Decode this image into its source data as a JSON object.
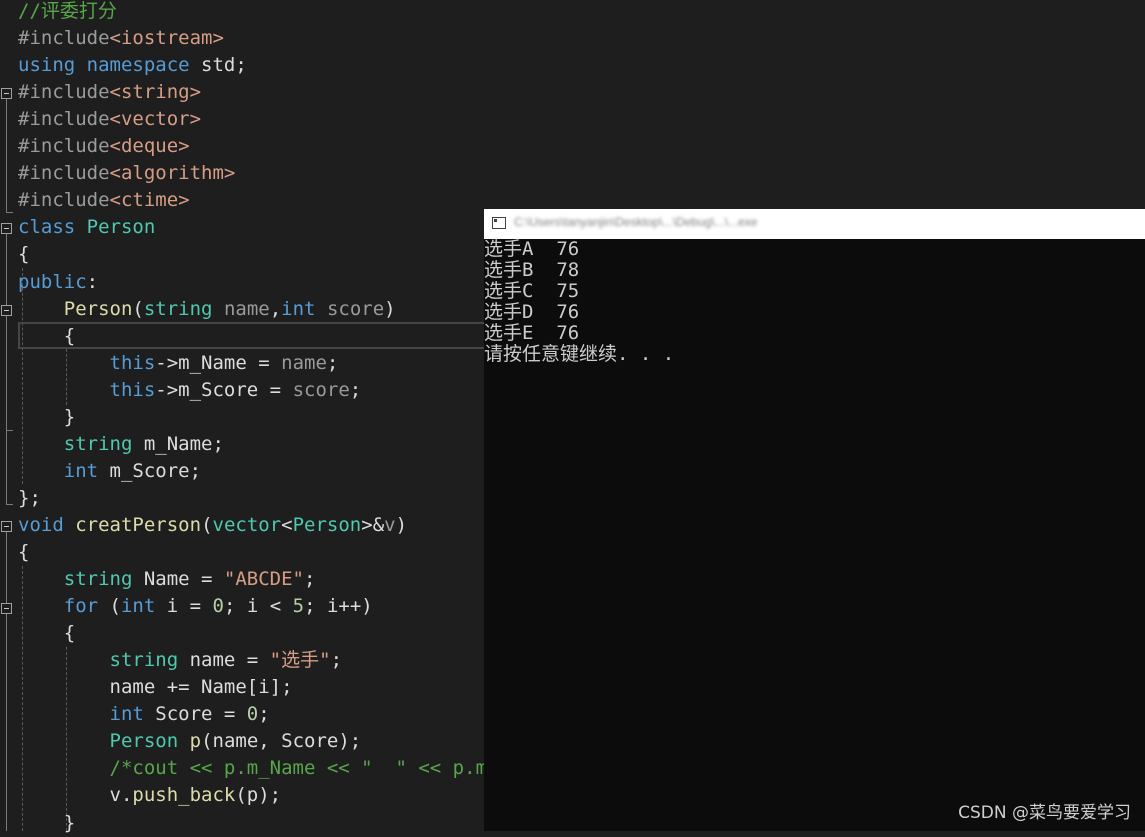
{
  "editor": {
    "lines": [
      [
        {
          "t": "//评委打分",
          "c": "com"
        }
      ],
      [
        {
          "t": "#include",
          "c": "pre"
        },
        {
          "t": "<iostream>",
          "c": "str"
        }
      ],
      [
        {
          "t": "using",
          "c": "kw"
        },
        {
          "t": " ",
          "c": "txt"
        },
        {
          "t": "namespace",
          "c": "kw"
        },
        {
          "t": " std;",
          "c": "txt"
        }
      ],
      [
        {
          "t": "#include",
          "c": "pre"
        },
        {
          "t": "<string>",
          "c": "str"
        }
      ],
      [
        {
          "t": "#include",
          "c": "pre"
        },
        {
          "t": "<vector>",
          "c": "str"
        }
      ],
      [
        {
          "t": "#include",
          "c": "pre"
        },
        {
          "t": "<deque>",
          "c": "str"
        }
      ],
      [
        {
          "t": "#include",
          "c": "pre"
        },
        {
          "t": "<algorithm>",
          "c": "str"
        }
      ],
      [
        {
          "t": "#include",
          "c": "pre"
        },
        {
          "t": "<ctime>",
          "c": "str"
        }
      ],
      [
        {
          "t": "class",
          "c": "kw"
        },
        {
          "t": " ",
          "c": "txt"
        },
        {
          "t": "Person",
          "c": "type"
        }
      ],
      [
        {
          "t": "{",
          "c": "txt"
        }
      ],
      [
        {
          "t": "public",
          "c": "kw"
        },
        {
          "t": ":",
          "c": "txt"
        }
      ],
      [
        {
          "t": "    ",
          "c": "txt"
        },
        {
          "t": "Person",
          "c": "fn"
        },
        {
          "t": "(",
          "c": "txt"
        },
        {
          "t": "string",
          "c": "type"
        },
        {
          "t": " ",
          "c": "txt"
        },
        {
          "t": "name",
          "c": "par"
        },
        {
          "t": ",",
          "c": "txt"
        },
        {
          "t": "int",
          "c": "kw"
        },
        {
          "t": " ",
          "c": "txt"
        },
        {
          "t": "score",
          "c": "par"
        },
        {
          "t": ")",
          "c": "txt"
        }
      ],
      [
        {
          "t": "    {",
          "c": "txt"
        }
      ],
      [
        {
          "t": "        ",
          "c": "txt"
        },
        {
          "t": "this",
          "c": "kw"
        },
        {
          "t": "->m_Name = ",
          "c": "txt"
        },
        {
          "t": "name",
          "c": "par"
        },
        {
          "t": ";",
          "c": "txt"
        }
      ],
      [
        {
          "t": "        ",
          "c": "txt"
        },
        {
          "t": "this",
          "c": "kw"
        },
        {
          "t": "->m_Score = ",
          "c": "txt"
        },
        {
          "t": "score",
          "c": "par"
        },
        {
          "t": ";",
          "c": "txt"
        }
      ],
      [
        {
          "t": "    }",
          "c": "txt"
        }
      ],
      [
        {
          "t": "    ",
          "c": "txt"
        },
        {
          "t": "string",
          "c": "type"
        },
        {
          "t": " m_Name;",
          "c": "txt"
        }
      ],
      [
        {
          "t": "    ",
          "c": "txt"
        },
        {
          "t": "int",
          "c": "kw"
        },
        {
          "t": " m_Score;",
          "c": "txt"
        }
      ],
      [
        {
          "t": "};",
          "c": "txt"
        }
      ],
      [
        {
          "t": "void",
          "c": "kw"
        },
        {
          "t": " ",
          "c": "txt"
        },
        {
          "t": "creatPerson",
          "c": "fn"
        },
        {
          "t": "(",
          "c": "txt"
        },
        {
          "t": "vector",
          "c": "type"
        },
        {
          "t": "<",
          "c": "txt"
        },
        {
          "t": "Person",
          "c": "type"
        },
        {
          "t": ">&",
          "c": "txt"
        },
        {
          "t": "v",
          "c": "par"
        },
        {
          "t": ")",
          "c": "txt"
        }
      ],
      [
        {
          "t": "{",
          "c": "txt"
        }
      ],
      [
        {
          "t": "    ",
          "c": "txt"
        },
        {
          "t": "string",
          "c": "type"
        },
        {
          "t": " Name = ",
          "c": "txt"
        },
        {
          "t": "\"ABCDE\"",
          "c": "str"
        },
        {
          "t": ";",
          "c": "txt"
        }
      ],
      [
        {
          "t": "    ",
          "c": "txt"
        },
        {
          "t": "for",
          "c": "kw"
        },
        {
          "t": " (",
          "c": "txt"
        },
        {
          "t": "int",
          "c": "kw"
        },
        {
          "t": " i = ",
          "c": "txt"
        },
        {
          "t": "0",
          "c": "num"
        },
        {
          "t": "; i < ",
          "c": "txt"
        },
        {
          "t": "5",
          "c": "num"
        },
        {
          "t": "; i++)",
          "c": "txt"
        }
      ],
      [
        {
          "t": "    {",
          "c": "txt"
        }
      ],
      [
        {
          "t": "        ",
          "c": "txt"
        },
        {
          "t": "string",
          "c": "type"
        },
        {
          "t": " name = ",
          "c": "txt"
        },
        {
          "t": "\"选手\"",
          "c": "str"
        },
        {
          "t": ";",
          "c": "txt"
        }
      ],
      [
        {
          "t": "        name += Name[i];",
          "c": "txt"
        }
      ],
      [
        {
          "t": "        ",
          "c": "txt"
        },
        {
          "t": "int",
          "c": "kw"
        },
        {
          "t": " Score = ",
          "c": "txt"
        },
        {
          "t": "0",
          "c": "num"
        },
        {
          "t": ";",
          "c": "txt"
        }
      ],
      [
        {
          "t": "        ",
          "c": "txt"
        },
        {
          "t": "Person",
          "c": "type"
        },
        {
          "t": " ",
          "c": "txt"
        },
        {
          "t": "p",
          "c": "fn"
        },
        {
          "t": "(name, Score);",
          "c": "txt"
        }
      ],
      [
        {
          "t": "        ",
          "c": "txt"
        },
        {
          "t": "/*cout << p.m_Name << \"  \" << p.m_S",
          "c": "com"
        }
      ],
      [
        {
          "t": "        v.",
          "c": "txt"
        },
        {
          "t": "push_back",
          "c": "fn"
        },
        {
          "t": "(p);",
          "c": "txt"
        }
      ],
      [
        {
          "t": "    }",
          "c": "txt"
        }
      ]
    ]
  },
  "console": {
    "title": "C:\\Users\\tanyanjin\\Desktop\\...\\Debug\\...\\...exe",
    "output": [
      "选手A  76",
      "选手B  78",
      "选手C  75",
      "选手D  76",
      "选手E  76",
      "请按任意键继续. . ."
    ]
  },
  "watermark": "CSDN @菜鸟要爱学习"
}
